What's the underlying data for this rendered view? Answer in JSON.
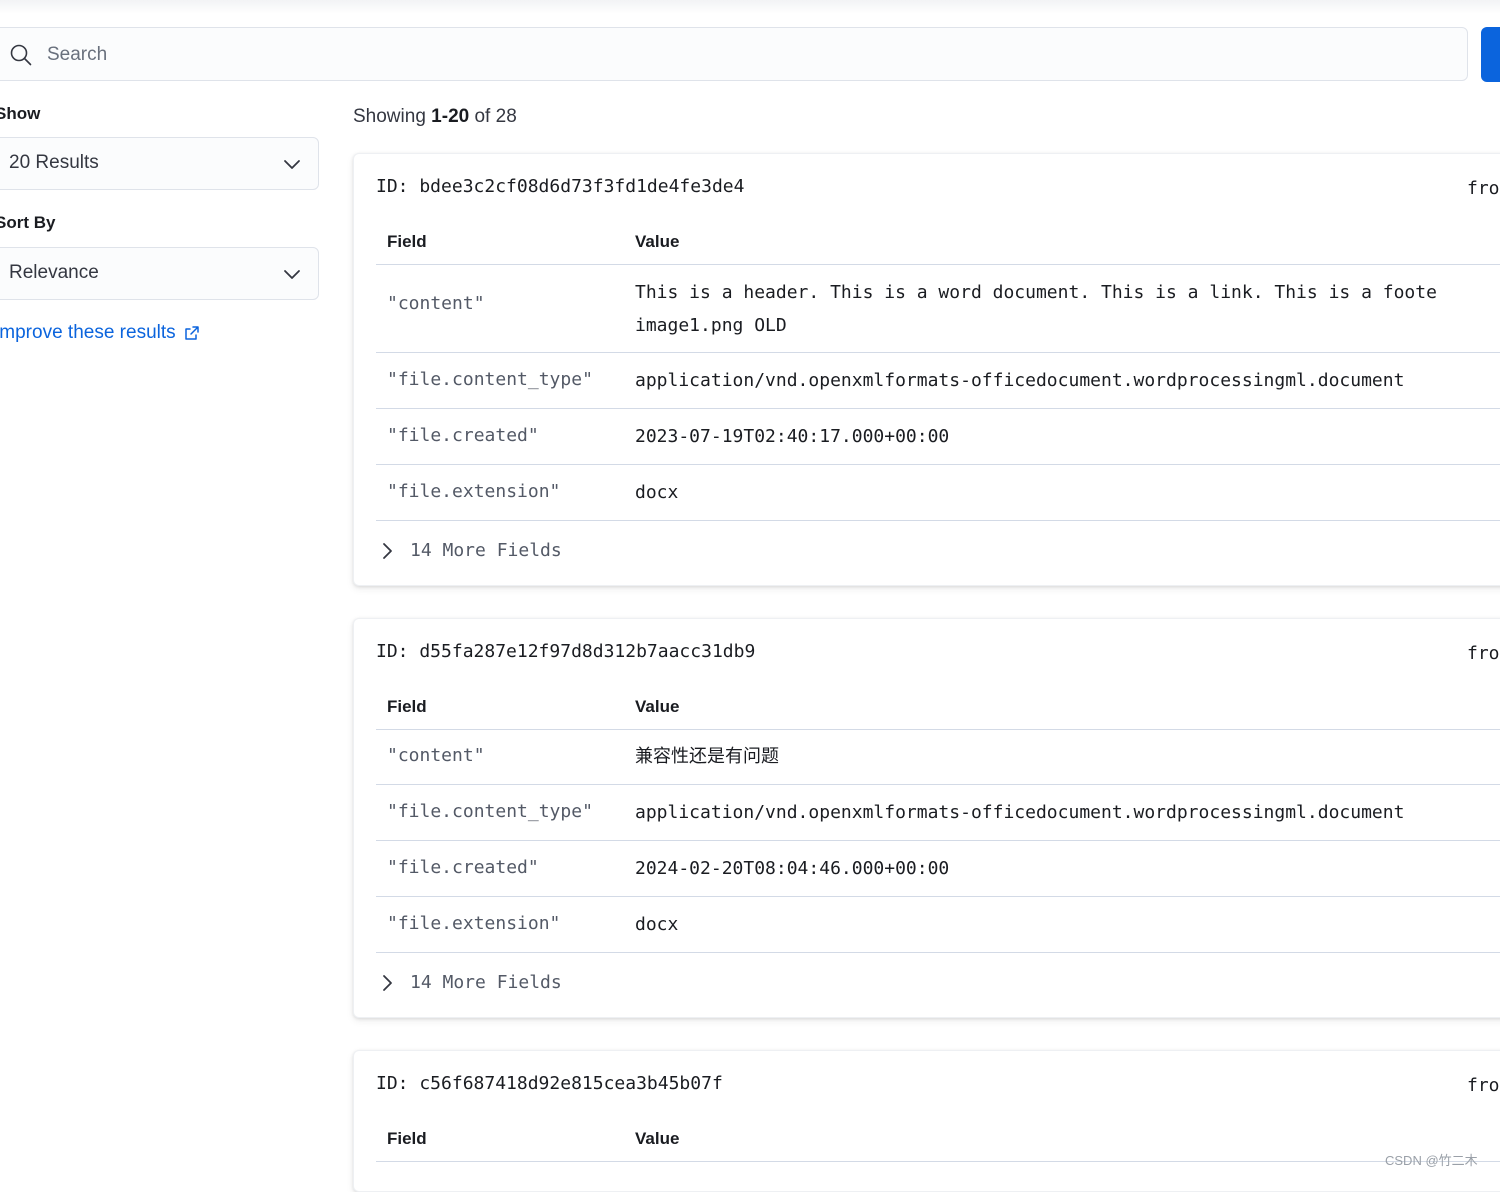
{
  "search": {
    "placeholder": "Search",
    "value": ""
  },
  "sidebar": {
    "show_label": "Show",
    "show_value": "20 Results",
    "sort_label": "Sort By",
    "sort_value": "Relevance",
    "improve_link": "Improve these results"
  },
  "results": {
    "showing_prefix": "Showing",
    "showing_range": "1-20",
    "showing_of": "of",
    "showing_total": "28",
    "field_header": "Field",
    "value_header": "Value",
    "cards": [
      {
        "id": "ID: bdee3c2cf08d6d73f3fd1de4fe3de4",
        "from": "fro",
        "rows": [
          {
            "field": "\"content\"",
            "value": "This is a header. This is a word document. This is a link. This is a foote\nimage1.png OLD"
          },
          {
            "field": "\"file.content_type\"",
            "value": "application/vnd.openxmlformats-officedocument.wordprocessingml.document"
          },
          {
            "field": "\"file.created\"",
            "value": "2023-07-19T02:40:17.000+00:00"
          },
          {
            "field": "\"file.extension\"",
            "value": "docx"
          }
        ],
        "more": "14 More Fields"
      },
      {
        "id": "ID: d55fa287e12f97d8d312b7aacc31db9",
        "from": "fro",
        "rows": [
          {
            "field": "\"content\"",
            "value": "兼容性还是有问题"
          },
          {
            "field": "\"file.content_type\"",
            "value": "application/vnd.openxmlformats-officedocument.wordprocessingml.document"
          },
          {
            "field": "\"file.created\"",
            "value": "2024-02-20T08:04:46.000+00:00"
          },
          {
            "field": "\"file.extension\"",
            "value": "docx"
          }
        ],
        "more": "14 More Fields"
      },
      {
        "id": "ID: c56f687418d92e815cea3b45b07f",
        "from": "fro",
        "rows": [],
        "more": ""
      }
    ]
  },
  "watermark": "CSDN @竹二木",
  "colors": {
    "accent": "#0b64dd",
    "border": "#d3dae6",
    "text": "#1a1c21",
    "muted": "#535966"
  }
}
